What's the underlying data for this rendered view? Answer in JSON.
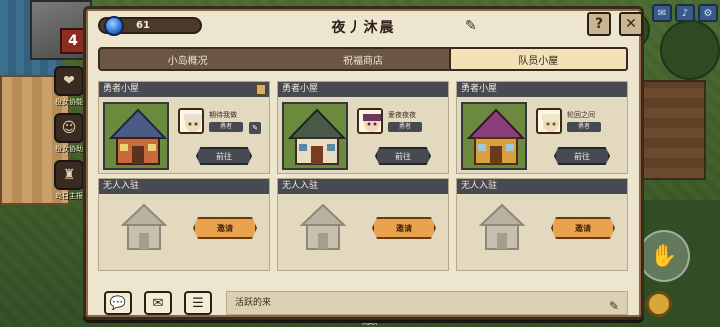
{
  "hud": {
    "level_badge": "4",
    "left_labels": [
      "",
      "橙女协能",
      "橙女协助",
      "岛日主报"
    ],
    "max_label": "MAX"
  },
  "panel": {
    "resource_count": "61",
    "title": "夜丿沐晨",
    "help_label": "?",
    "close_label": "✕"
  },
  "tabs": [
    {
      "label": "小岛概况",
      "active": false
    },
    {
      "label": "祝福商店",
      "active": false
    },
    {
      "label": "队员小屋",
      "active": true
    }
  ],
  "cabins": [
    {
      "header": "勇者小屋",
      "mate_name": "期待我做",
      "role": "勇者",
      "goto_label": "前往",
      "empty_header": "无人入驻",
      "invite_label": "邀请"
    },
    {
      "header": "勇者小屋",
      "mate_name": "爱夜夜夜",
      "role": "勇者",
      "goto_label": "前往",
      "empty_header": "无人入驻",
      "invite_label": "邀请"
    },
    {
      "header": "勇者小屋",
      "mate_name": "轮回之间",
      "role": "勇者",
      "goto_label": "前往",
      "empty_header": "无人入驻",
      "invite_label": "邀请"
    }
  ],
  "signature": {
    "text": "活跃的来"
  },
  "icons": {
    "gem": "gem-icon",
    "edit": "pencil-icon",
    "chat": "chat-icon",
    "mail": "mail-icon",
    "notes": "notes-icon"
  }
}
